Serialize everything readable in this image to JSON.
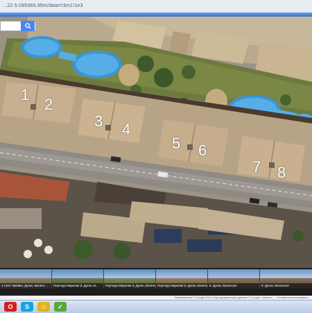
{
  "browser": {
    "address": "...22.5.095369,95m/data=!3m1!1e3"
  },
  "map": {
    "search": {
      "placeholder": "",
      "icon": "search-icon"
    },
    "unit_numbers": [
      "1",
      "2",
      "3",
      "4",
      "5",
      "6",
      "7",
      "8"
    ]
  },
  "thumbnails": [
    {
      "label": "4 Сент Змейка, Дуган, Валент..."
    },
    {
      "label": "Партида Мареник 8, Дуган, В..."
    },
    {
      "label": "Партида Мареник 3, Дуган, Валенсия"
    },
    {
      "label": "Партида Мареник 6, Дуган, Валенсия"
    },
    {
      "label": "8, Дуган, Валенсия"
    },
    {
      "label": "8, Дуган, Валенсия"
    }
  ],
  "credits": "Изображения © Google 2015, Картографические данные © Google, Sanborn ..., Условия использования  ...",
  "taskbar": {
    "items": [
      {
        "name": "opera-icon",
        "glyph": "O",
        "color": "#d21f1f"
      },
      {
        "name": "skype-icon",
        "glyph": "S",
        "color": "#14a4e6"
      },
      {
        "name": "chat-icon",
        "glyph": "☺",
        "color": "#e2b21f"
      },
      {
        "name": "bookmark-icon",
        "glyph": "✓",
        "color": "#5aa838"
      }
    ]
  }
}
